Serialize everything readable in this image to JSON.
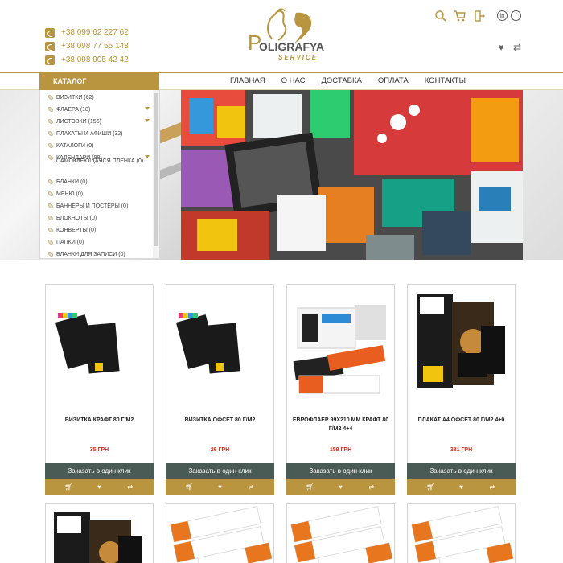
{
  "header": {
    "phones": [
      "+38 099 62 227 62",
      "+38 098 77 55 143",
      "+38 098 905 42 42"
    ],
    "logo": {
      "main": "OLIGRAFYA",
      "initial": "P",
      "sub": "SERVICE"
    },
    "social": [
      "in",
      "f"
    ],
    "colors": {
      "accent": "#b8953e",
      "dark": "#4a5a55"
    }
  },
  "nav": {
    "catalog_label": "КАТАЛОГ",
    "menu": [
      "ГЛАВНАЯ",
      "О НАС",
      "ДОСТАВКА",
      "ОПЛАТА",
      "КОНТАКТЫ"
    ]
  },
  "catalog": {
    "items": [
      {
        "label": "ВИЗИТКИ (62)",
        "expandable": false
      },
      {
        "label": "ФЛАЕРА (18)",
        "expandable": true
      },
      {
        "label": "ЛИСТОВКИ (156)",
        "expandable": true
      },
      {
        "label": "ПЛАКАТЫ И АФИШИ (32)",
        "expandable": false
      },
      {
        "label": "КАТАЛОГИ (0)",
        "expandable": false
      },
      {
        "label": "КАЛЕНДАРИ (98)",
        "expandable": true
      },
      {
        "label": "САМОКЛЕЮЩАЯСЯ ПЛЕНКА (0)",
        "expandable": false
      },
      {
        "label": "БЛАНКИ (0)",
        "expandable": false
      },
      {
        "label": "МЕНЮ (0)",
        "expandable": false
      },
      {
        "label": "БАННЕРЫ И ПОСТЕРЫ (0)",
        "expandable": false
      },
      {
        "label": "БЛОКНОТЫ (0)",
        "expandable": false
      },
      {
        "label": "КОНВЕРТЫ (0)",
        "expandable": false
      },
      {
        "label": "ПАПКИ (0)",
        "expandable": false
      },
      {
        "label": "БЛАНКИ ДЛЯ ЗАПИСИ (0)",
        "expandable": false
      }
    ]
  },
  "products": [
    {
      "title": "ВИЗИТКА КРАФТ 80 Г/М2",
      "price": "35 ГРН",
      "buy": "Заказать в один клик",
      "image": "business-cards"
    },
    {
      "title": "ВИЗИТКА ОФСЕТ 80 Г/М2",
      "price": "26 ГРН",
      "buy": "Заказать в один клик",
      "image": "business-cards"
    },
    {
      "title": "ЕВРОФЛАЕР 99Х210 ММ КРАФТ 80 Г/М2 4+4",
      "price": "159 ГРН",
      "buy": "Заказать в один клик",
      "image": "flyers"
    },
    {
      "title": "ПЛАКАТ А4 ОФСЕТ 80 Г/М2 4+0",
      "price": "381 ГРН",
      "buy": "Заказать в один клик",
      "image": "posters"
    }
  ]
}
